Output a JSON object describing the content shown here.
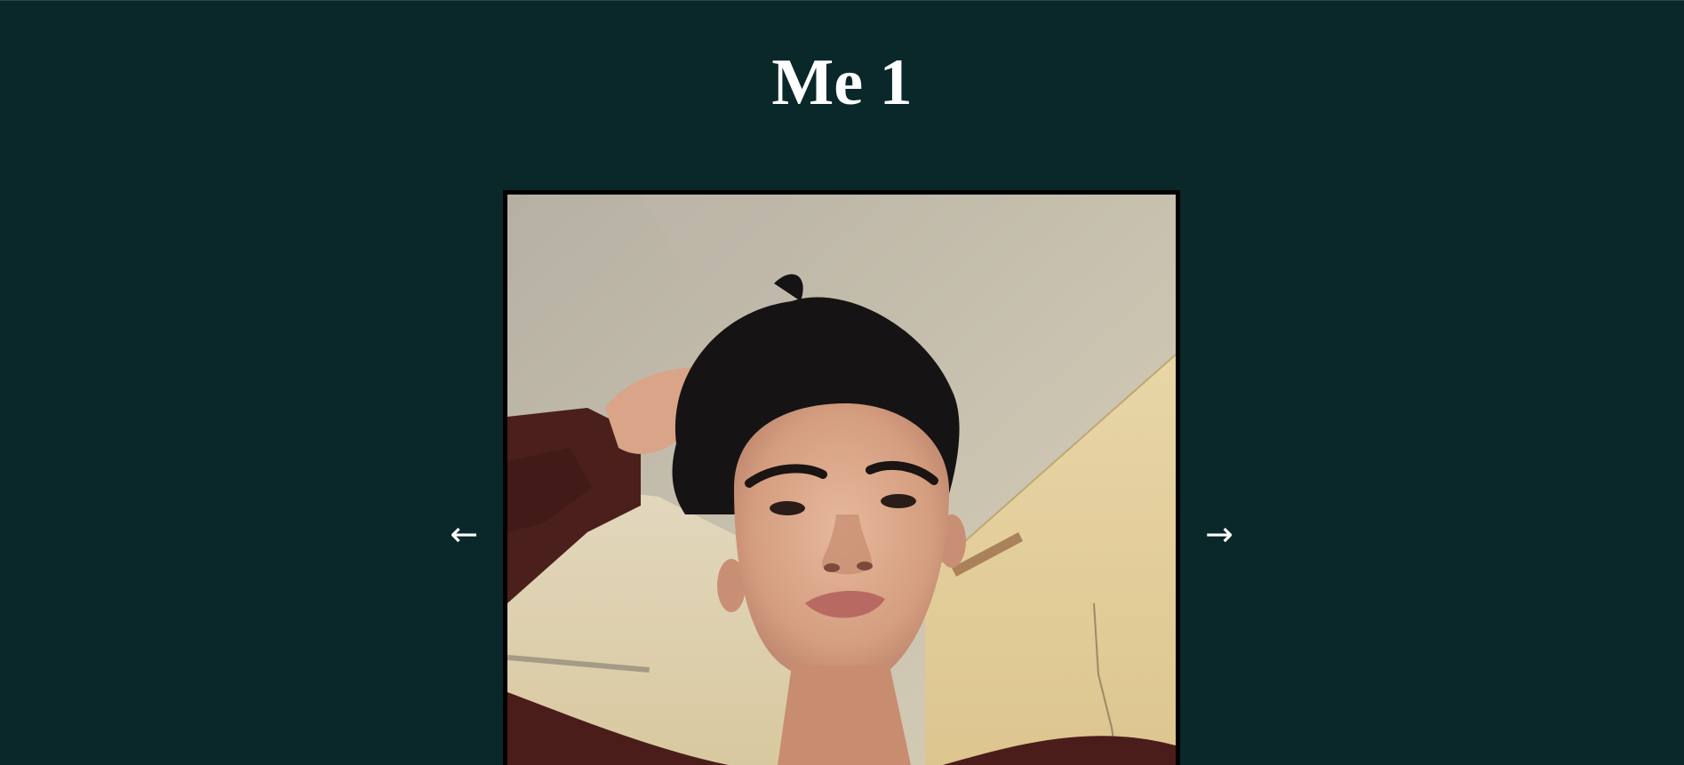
{
  "slideshow": {
    "title": "Me 1",
    "prev_label": "←",
    "next_label": "→",
    "photo": {
      "subject": "selfie-photo"
    }
  },
  "colors": {
    "background": "#0a2829",
    "title_text": "#ffffff",
    "frame_border": "#000000"
  }
}
